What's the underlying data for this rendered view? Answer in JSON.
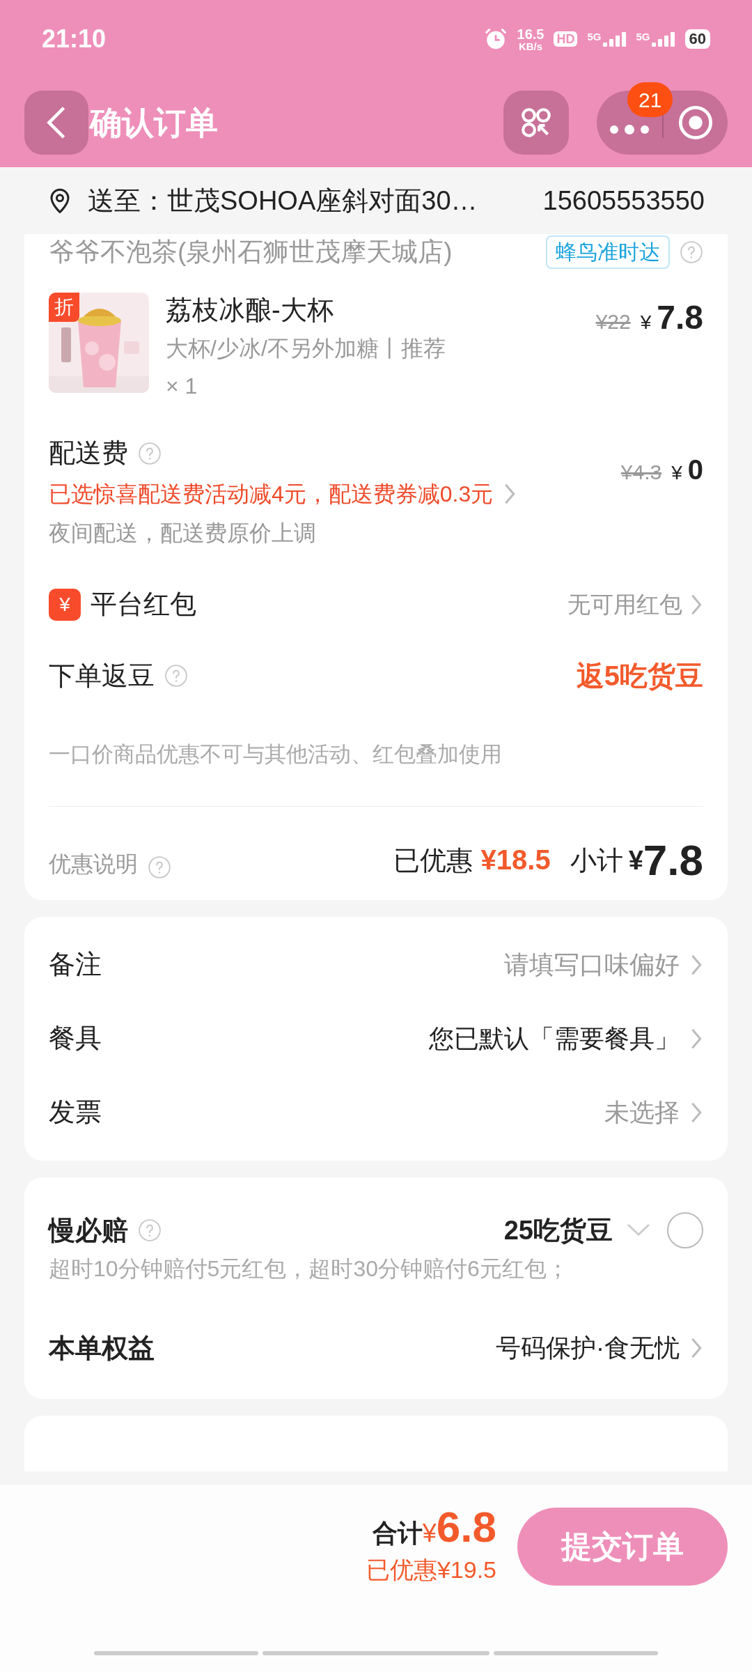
{
  "status_bar": {
    "time": "21:10",
    "speed_value": "16.5",
    "speed_unit": "KB/s",
    "hd": "HD",
    "sim_labels": [
      "5G",
      "5G"
    ],
    "battery": "60"
  },
  "nav": {
    "title": "确认订单",
    "badge": "21"
  },
  "address": {
    "label": "送至：",
    "text": "世茂SOHOA座斜对面30…",
    "phone": "15605553550"
  },
  "store": {
    "name": "爷爷不泡茶(泉州石狮世茂摩天城店)",
    "tag": "蜂鸟准时达"
  },
  "item": {
    "badge": "折",
    "name": "荔枝冰酿-大杯",
    "specs": "大杯/少冰/不另外加糖丨推荐",
    "qty": "× 1",
    "old_price": "¥22",
    "currency": "¥",
    "price": "7.8"
  },
  "delivery": {
    "label": "配送费",
    "promo": "已选惊喜配送费活动减4元，配送费券减0.3元",
    "note": "夜间配送，配送费原价上调",
    "old_price": "¥4.3",
    "currency": "¥",
    "price": "0"
  },
  "red_packet": {
    "icon": "¥",
    "label": "平台红包",
    "value": "无可用红包"
  },
  "beans": {
    "label": "下单返豆",
    "value": "返5吃货豆"
  },
  "notice": "一口价商品优惠不可与其他活动、红包叠加使用",
  "summary": {
    "discount_label": "优惠说明",
    "saved_label": "已优惠",
    "saved": "¥18.5",
    "subtotal_label": "小计",
    "currency": "¥",
    "subtotal": "7.8"
  },
  "options": [
    {
      "label": "备注",
      "value": "请填写口味偏好",
      "muted": true
    },
    {
      "label": "餐具",
      "value": "您已默认「需要餐具」",
      "muted": false
    },
    {
      "label": "发票",
      "value": "未选择",
      "muted": true
    }
  ],
  "slow_pay": {
    "label": "慢必赔",
    "value": "25吃货豆",
    "checked": false,
    "desc": "超时10分钟赔付5元红包，超时30分钟赔付6元红包；"
  },
  "benefits": {
    "label": "本单权益",
    "value": "号码保护·食无忧"
  },
  "footer": {
    "total_label": "合计",
    "currency": "¥",
    "total": "6.8",
    "saved": "已优惠¥19.5",
    "submit": "提交订单"
  }
}
